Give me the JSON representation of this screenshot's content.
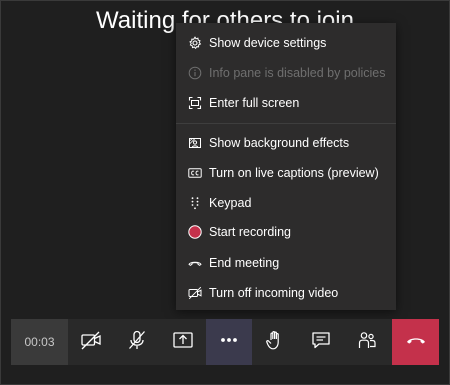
{
  "title": "Waiting for others to join",
  "menu": {
    "items": [
      {
        "label": "Show device settings",
        "icon": "gear-icon",
        "enabled": true
      },
      {
        "label": "Info pane is disabled by policies",
        "icon": "info-icon",
        "enabled": false
      },
      {
        "label": "Enter full screen",
        "icon": "fullscreen-icon",
        "enabled": true
      },
      {
        "label": "Show background effects",
        "icon": "background-effects-icon",
        "enabled": true
      },
      {
        "label": "Turn on live captions (preview)",
        "icon": "captions-icon",
        "enabled": true
      },
      {
        "label": "Keypad",
        "icon": "keypad-icon",
        "enabled": true
      },
      {
        "label": "Start recording",
        "icon": "record-icon",
        "enabled": true
      },
      {
        "label": "End meeting",
        "icon": "end-meeting-icon",
        "enabled": true
      },
      {
        "label": "Turn off incoming video",
        "icon": "video-off-icon",
        "enabled": true
      }
    ]
  },
  "toolbar": {
    "timer": "00:03",
    "buttons": [
      {
        "name": "camera-toggle",
        "icon": "camera-off-icon"
      },
      {
        "name": "mic-toggle",
        "icon": "mic-off-icon"
      },
      {
        "name": "share-content",
        "icon": "share-tray-icon"
      },
      {
        "name": "more-actions",
        "icon": "more-icon",
        "active": true
      },
      {
        "name": "raise-hand",
        "icon": "hand-icon"
      },
      {
        "name": "show-conversation",
        "icon": "chat-icon"
      },
      {
        "name": "show-participants",
        "icon": "participants-icon"
      },
      {
        "name": "hang-up",
        "icon": "hangup-icon"
      }
    ]
  },
  "colors": {
    "background": "#1f1f1f",
    "menu": "#2d2c2c",
    "toolbar": "#292929",
    "active": "#3b3a4d",
    "hangup": "#c4314b",
    "record": "#c4314b"
  }
}
